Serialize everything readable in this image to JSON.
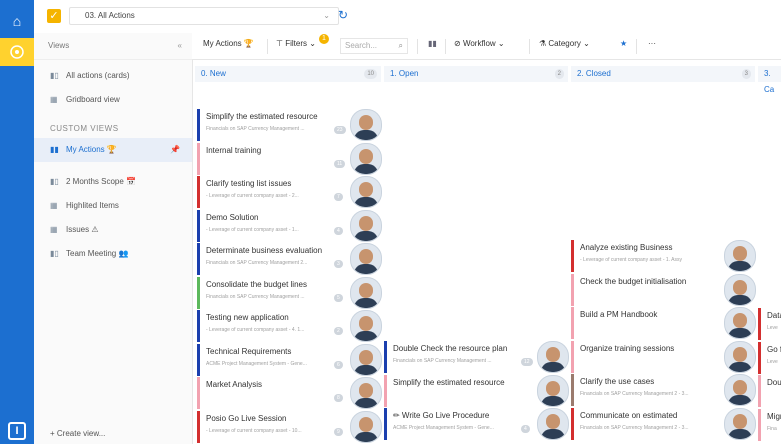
{
  "app": {
    "project_name": "03. All Actions",
    "icons": {
      "home": "home-icon",
      "active_app": "kanban-icon",
      "logo": "app-logo-icon",
      "refresh": "refresh-icon"
    }
  },
  "colors": {
    "accent": "#1c6fd0",
    "highlight": "#ffd22e",
    "blue": "#1b3fae",
    "red": "#d32f2f",
    "pink": "#f2a2b0",
    "green": "#5cb85c",
    "brown": "#9b7b6e"
  },
  "views": {
    "header": "Views",
    "collapse": "«",
    "items": [
      {
        "label": "All actions (cards)",
        "icon": "chart-icon"
      },
      {
        "label": "Gridboard view",
        "icon": "grid-icon"
      }
    ],
    "custom_label": "CUSTOM VIEWS",
    "custom_items": [
      {
        "label": "My Actions 🏆",
        "icon": "chart-icon",
        "active": true
      },
      {
        "label": "2 Months Scope 📅",
        "icon": "chart-icon"
      },
      {
        "label": "Highlited Items",
        "icon": "grid-icon"
      },
      {
        "label": "Issues ⚠",
        "icon": "grid-icon"
      },
      {
        "label": "Team Meeting 👥",
        "icon": "chart-icon"
      }
    ],
    "create": "+ Create view..."
  },
  "toolbar": {
    "title": "My Actions 🏆",
    "filters": "Filters",
    "filters_badge": "1",
    "search_placeholder": "Search...",
    "workflow": "Workflow",
    "category": "Category",
    "more": "···"
  },
  "columns": [
    {
      "title": "0. New",
      "count": "10"
    },
    {
      "title": "1. Open",
      "count": "2"
    },
    {
      "title": "2. Closed",
      "count": "3"
    },
    {
      "title": "3. Ca",
      "count": ""
    }
  ],
  "cards": {
    "col0": [
      {
        "title": "Simplify the estimated resource",
        "sub": "Financials on SAP Currency Management ...",
        "pill": "23",
        "color": "blue"
      },
      {
        "title": "Internal training",
        "sub": "",
        "pill": "11",
        "color": "pink"
      },
      {
        "title": "Clarify testing list issues",
        "sub": "- Leverage of current company asset - 2...",
        "pill": "7",
        "color": "red"
      },
      {
        "title": "Demo Solution",
        "sub": "- Leverage of current company asset - 1...",
        "pill": "4",
        "color": "blue"
      },
      {
        "title": "Determinate business evaluation",
        "sub": "Financials on SAP Currency Management 2...",
        "pill": "3",
        "color": "blue"
      },
      {
        "title": "Consolidate the budget lines",
        "sub": "Financials on SAP Currency Management ...",
        "pill": "5",
        "color": "green"
      },
      {
        "title": "Testing new application",
        "sub": "- Leverage of current company asset - 4. 1...",
        "pill": "2",
        "color": "blue"
      },
      {
        "title": "Technical Requirements",
        "sub": "ACME Project Management System - Gene...",
        "pill": "6",
        "color": "blue"
      },
      {
        "title": "Market Analysis",
        "sub": "",
        "pill": "8",
        "color": "pink"
      },
      {
        "title": "Posio Go Live Session",
        "sub": "- Leverage of current company asset - 10...",
        "pill": "9",
        "color": "red"
      }
    ],
    "col1": [
      {
        "title": "Double Check the resource plan",
        "sub": "Financials on SAP Currency Management ...",
        "pill": "12",
        "color": "blue"
      },
      {
        "title": "Simplify the estimated resource",
        "sub": "",
        "pill": "",
        "color": "pink"
      },
      {
        "title": "✏ Write Go Live Procedure",
        "sub": "ACME Project Management System - Gene...",
        "pill": "4",
        "color": "blue"
      }
    ],
    "col2": [
      {
        "title": "Analyze existing Business",
        "sub": "- Leverage of current company asset - 1. Assy",
        "pill": "",
        "color": "red"
      },
      {
        "title": "Check the budget initialisation",
        "sub": "",
        "pill": "",
        "color": "pink"
      },
      {
        "title": "Build a PM Handbook",
        "sub": "",
        "pill": "",
        "color": "pink"
      },
      {
        "title": "Organize training sessions",
        "sub": "",
        "pill": "",
        "color": "pink"
      },
      {
        "title": "Clarify the use cases",
        "sub": "Financials on SAP Currency Management 2 - 3...",
        "pill": "",
        "color": "brown"
      },
      {
        "title": "Communicate on estimated",
        "sub": "Financials on SAP Currency Management 2 - 3...",
        "pill": "",
        "color": "red"
      }
    ],
    "col3": [
      {
        "title": "Data",
        "sub": "Leve",
        "color": "red"
      },
      {
        "title": "Go f",
        "sub": "Leve",
        "color": "red"
      },
      {
        "title": "Dou",
        "sub": "",
        "color": "pink"
      },
      {
        "title": "Migr",
        "sub": "Fina",
        "color": "pink"
      }
    ]
  }
}
